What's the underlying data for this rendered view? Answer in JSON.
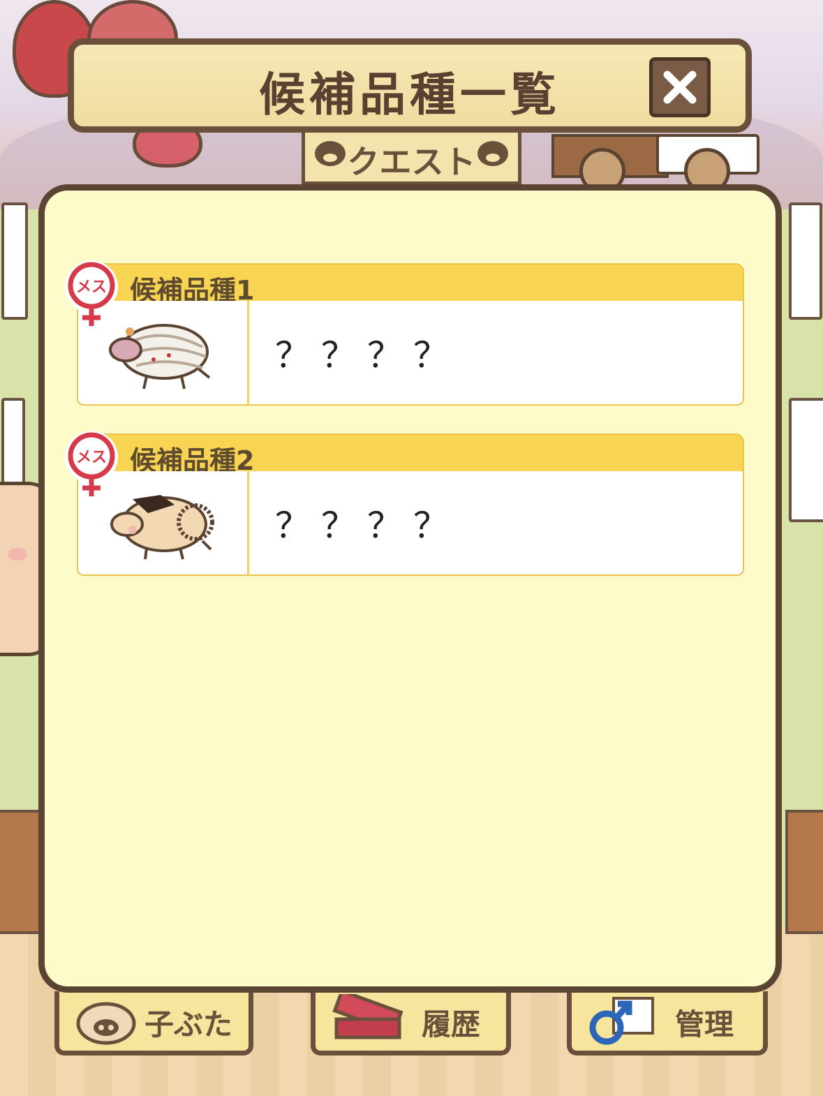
{
  "header": {
    "title": "候補品種一覧",
    "close_icon": "close-x-icon"
  },
  "background": {
    "quest_sign": "クエスト"
  },
  "candidates": [
    {
      "label": "候補品種1",
      "name": "？？？？",
      "gender_badge": "メス",
      "gender_icon": "female-symbol-icon",
      "thumb_icon": "bandaged-pig-icon"
    },
    {
      "label": "候補品種2",
      "name": "？？？？",
      "gender_badge": "メス",
      "gender_icon": "female-symbol-icon",
      "thumb_icon": "rope-pig-icon"
    }
  ],
  "bottom_tabs": [
    {
      "label": "子ぶた",
      "icon": "piglet-face-icon"
    },
    {
      "label": "履歴",
      "icon": "book-icon"
    },
    {
      "label": "管理",
      "icon": "male-symbol-icon"
    }
  ],
  "colors": {
    "panel_bg": "#fdfbc9",
    "card_header": "#f8d453",
    "frame_brown": "#5c4432",
    "badge_red": "#d63a4a"
  }
}
